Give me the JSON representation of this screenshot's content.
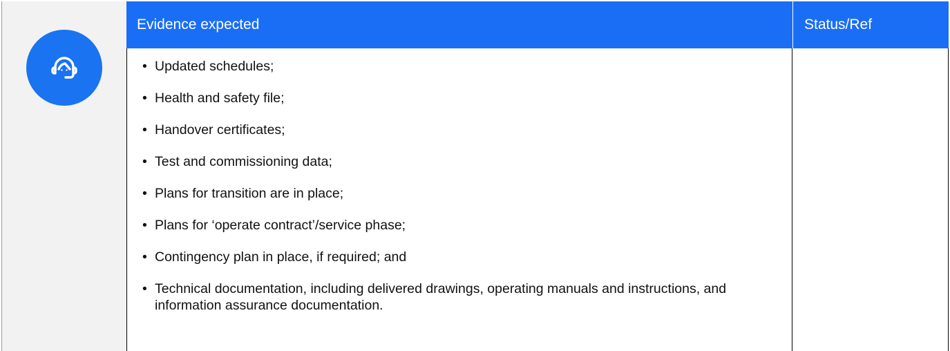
{
  "header": {
    "evidence_label": "Evidence expected",
    "status_label": "Status/Ref"
  },
  "icon": {
    "name": "support-headset-icon",
    "color": "#1a73f0"
  },
  "evidence_items": [
    "Updated schedules;",
    "Health and safety file;",
    "Handover certificates;",
    "Test and commissioning data;",
    "Plans for transition are in place;",
    "Plans for ‘operate contract’/service phase;",
    "Contingency plan in place, if required; and",
    "Technical documentation, including delivered drawings, operating manuals and instructions, and information assurance documentation."
  ],
  "status_ref": ""
}
